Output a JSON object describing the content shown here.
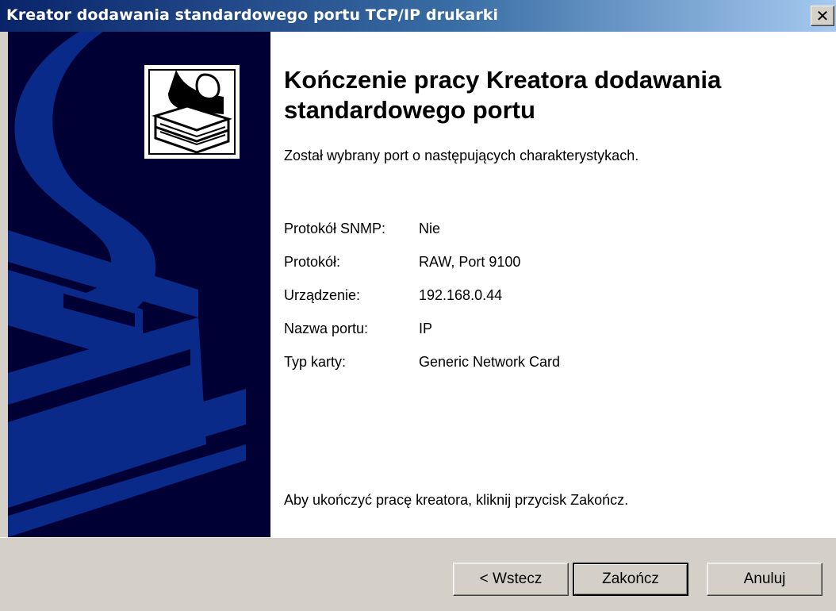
{
  "window": {
    "title": "Kreator dodawania standardowego portu TCP/IP drukarki",
    "close_glyph": "✕"
  },
  "page": {
    "heading": "Kończenie pracy Kreatora dodawania standardowego portu",
    "intro": "Został wybrany port o następujących charakterystykach.",
    "properties": [
      {
        "label": "Protokół SNMP:",
        "value": "Nie"
      },
      {
        "label": "Protokół:",
        "value": "RAW, Port 9100"
      },
      {
        "label": "Urządzenie:",
        "value": "192.168.0.44"
      },
      {
        "label": "Nazwa portu:",
        "value": "IP"
      },
      {
        "label": "Typ karty:",
        "value": "Generic Network Card"
      }
    ],
    "finish_hint": "Aby ukończyć pracę kreatora, kliknij przycisk Zakończ."
  },
  "buttons": {
    "back": "< Wstecz",
    "finish": "Zakończ",
    "cancel": "Anuluj"
  },
  "colors": {
    "titlebar_start": "#0a246a",
    "banner_background": "#000035",
    "banner_shapes": "#0a2a8a",
    "dialog_face": "#d4d0c8"
  }
}
